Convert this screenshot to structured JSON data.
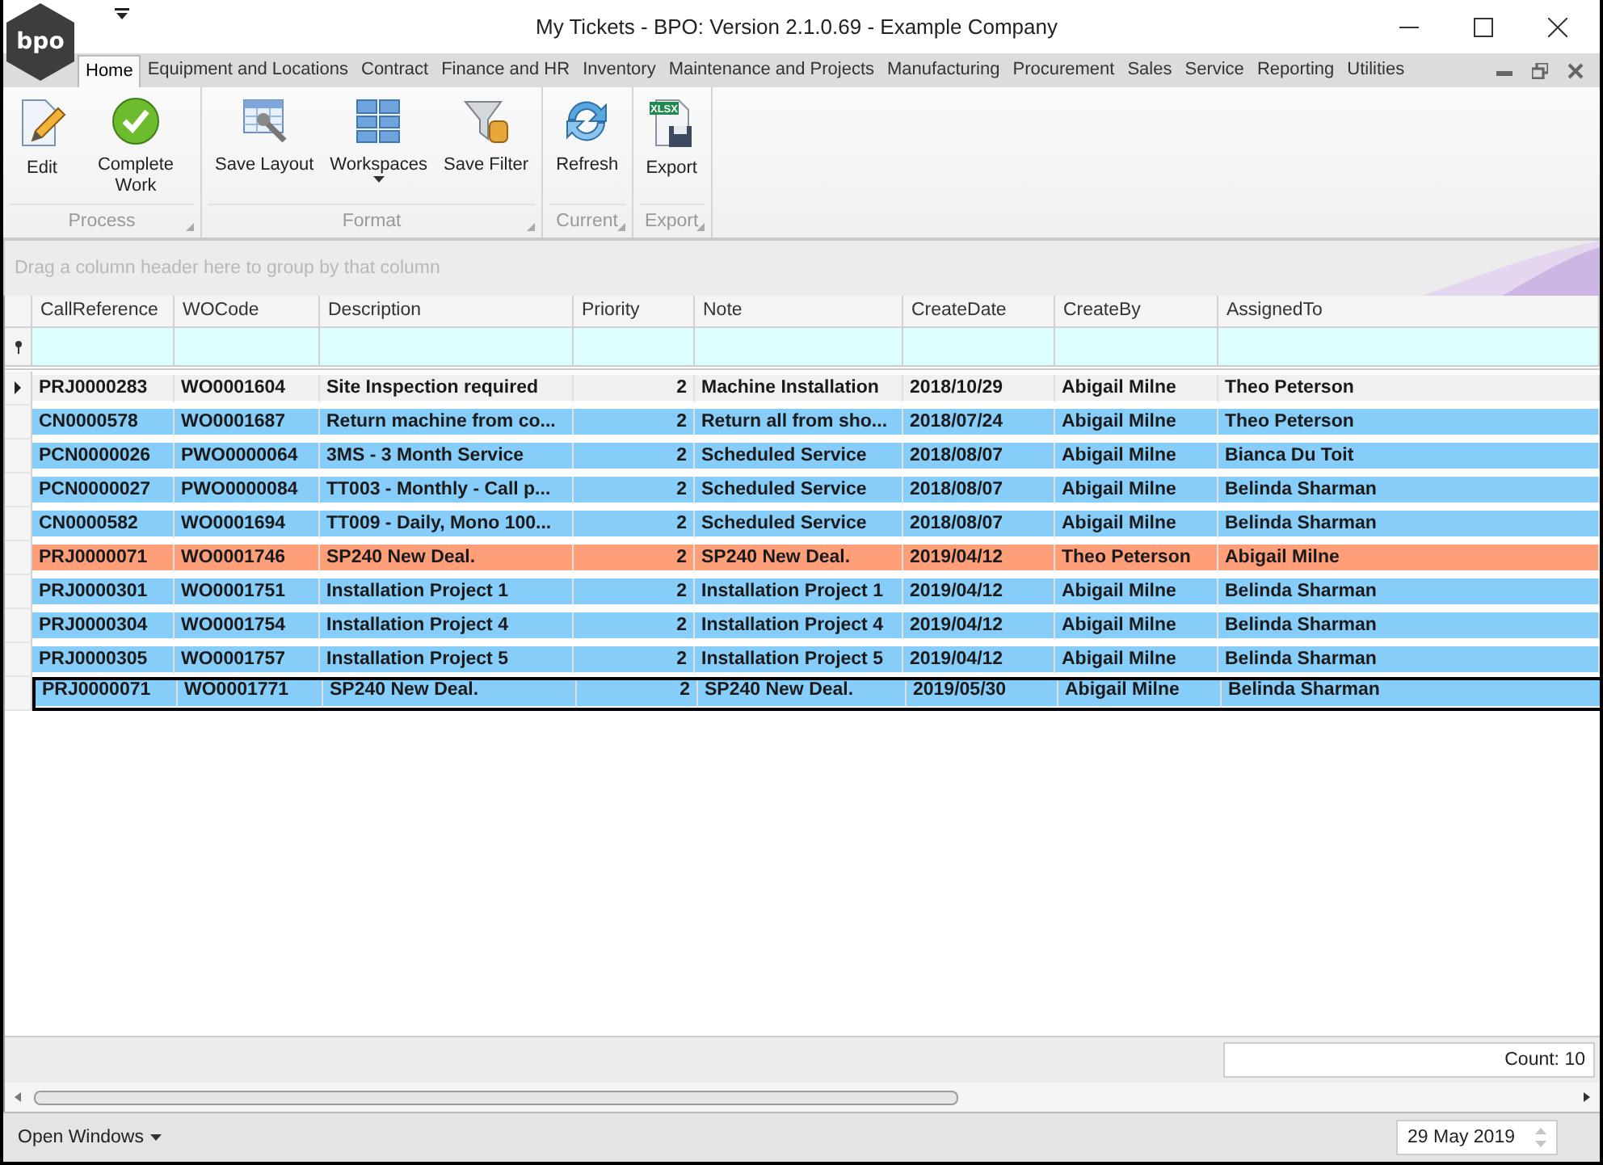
{
  "window": {
    "title": "My Tickets - BPO: Version 2.1.0.69 - Example Company",
    "logo": "bpo"
  },
  "ribbon_tabs": [
    {
      "label": "Home",
      "selected": true
    },
    {
      "label": "Equipment and Locations",
      "selected": false
    },
    {
      "label": "Contract",
      "selected": false
    },
    {
      "label": "Finance and HR",
      "selected": false
    },
    {
      "label": "Inventory",
      "selected": false
    },
    {
      "label": "Maintenance and Projects",
      "selected": false
    },
    {
      "label": "Manufacturing",
      "selected": false
    },
    {
      "label": "Procurement",
      "selected": false
    },
    {
      "label": "Sales",
      "selected": false
    },
    {
      "label": "Service",
      "selected": false
    },
    {
      "label": "Reporting",
      "selected": false
    },
    {
      "label": "Utilities",
      "selected": false
    }
  ],
  "ribbon_groups": [
    {
      "caption": "Process",
      "buttons": [
        {
          "label": "Edit",
          "kind": "edit",
          "dropdown": false
        },
        {
          "label": "Complete Work",
          "kind": "complete",
          "dropdown": false
        }
      ]
    },
    {
      "caption": "Format",
      "buttons": [
        {
          "label": "Save Layout",
          "kind": "layout",
          "dropdown": false
        },
        {
          "label": "Workspaces",
          "kind": "workspaces",
          "dropdown": true
        },
        {
          "label": "Save Filter",
          "kind": "filter",
          "dropdown": false
        }
      ]
    },
    {
      "caption": "Current",
      "buttons": [
        {
          "label": "Refresh",
          "kind": "refresh",
          "dropdown": false
        }
      ]
    },
    {
      "caption": "Export",
      "buttons": [
        {
          "label": "Export",
          "kind": "export",
          "dropdown": false,
          "icon_label": "XLSX"
        }
      ]
    }
  ],
  "group_panel": {
    "hint": "Drag a column header here to group by that column"
  },
  "table": {
    "columns": [
      "CallReference",
      "WOCode",
      "Description",
      "Priority",
      "Note",
      "CreateDate",
      "CreateBy",
      "AssignedTo"
    ],
    "rows": [
      {
        "cells": [
          "PRJ0000283",
          "WO0001604",
          "Site Inspection required",
          "2",
          "Machine Installation",
          "2018/10/29",
          "Abigail Milne",
          "Theo Peterson"
        ],
        "color": "#f0f0f0",
        "current": true,
        "selected": false
      },
      {
        "cells": [
          "CN0000578",
          "WO0001687",
          "Return machine from co...",
          "2",
          "Return all from sho...",
          "2018/07/24",
          "Abigail Milne",
          "Theo Peterson"
        ],
        "color": "#87cdf9",
        "current": false,
        "selected": false
      },
      {
        "cells": [
          "PCN0000026",
          "PWO0000064",
          "3MS - 3 Month Service",
          "2",
          "Scheduled Service",
          "2018/08/07",
          "Abigail Milne",
          "Bianca Du Toit"
        ],
        "color": "#87cdf9",
        "current": false,
        "selected": false
      },
      {
        "cells": [
          "PCN0000027",
          "PWO0000084",
          "TT003 -  Monthly - Call p...",
          "2",
          "Scheduled Service",
          "2018/08/07",
          "Abigail Milne",
          "Belinda Sharman"
        ],
        "color": "#87cdf9",
        "current": false,
        "selected": false
      },
      {
        "cells": [
          "CN0000582",
          "WO0001694",
          "TT009 - Daily, Mono 100...",
          "2",
          "Scheduled Service",
          "2018/08/07",
          "Abigail Milne",
          "Belinda Sharman"
        ],
        "color": "#87cdf9",
        "current": false,
        "selected": false
      },
      {
        "cells": [
          "PRJ0000071",
          "WO0001746",
          "SP240 New Deal.",
          "2",
          "SP240 New Deal.",
          "2019/04/12",
          "Theo Peterson",
          "Abigail Milne"
        ],
        "color": "#fe9f7a",
        "current": false,
        "selected": false
      },
      {
        "cells": [
          "PRJ0000301",
          "WO0001751",
          "Installation Project 1",
          "2",
          "Installation Project 1",
          "2019/04/12",
          "Abigail Milne",
          "Belinda Sharman"
        ],
        "color": "#87cdf9",
        "current": false,
        "selected": false
      },
      {
        "cells": [
          "PRJ0000304",
          "WO0001754",
          "Installation Project 4",
          "2",
          "Installation Project 4",
          "2019/04/12",
          "Abigail Milne",
          "Belinda Sharman"
        ],
        "color": "#87cdf9",
        "current": false,
        "selected": false
      },
      {
        "cells": [
          "PRJ0000305",
          "WO0001757",
          "Installation Project 5",
          "2",
          "Installation Project 5",
          "2019/04/12",
          "Abigail Milne",
          "Belinda Sharman"
        ],
        "color": "#87cdf9",
        "current": false,
        "selected": false
      },
      {
        "cells": [
          "PRJ0000071",
          "WO0001771",
          "SP240 New Deal.",
          "2",
          "SP240 New Deal.",
          "2019/05/30",
          "Abigail Milne",
          "Belinda Sharman"
        ],
        "color": "#87cdf9",
        "current": false,
        "selected": true
      }
    ]
  },
  "footer": {
    "count": "Count: 10"
  },
  "status_bar": {
    "open_windows": "Open Windows",
    "date": "29 May 2019"
  }
}
